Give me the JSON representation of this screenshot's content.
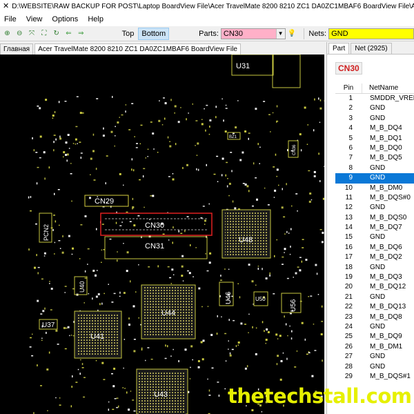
{
  "window": {
    "title": "D:\\WEBSITE\\RAW BACKUP FOR POST\\Laptop BoardView File\\Acer TravelMate 8200 8210 ZC1 DA0ZC1MBAF6 BoardView File\\Acer TravelMate 8200 8210 ZC1 DA0ZC1MBAF6 BoardView File"
  },
  "menu": [
    "File",
    "View",
    "Options",
    "Help"
  ],
  "toolbar": {
    "side_top": "Top",
    "side_bottom": "Bottom",
    "parts_label": "Parts:",
    "parts_value": "CN30",
    "nets_label": "Nets:",
    "nets_value": "GND",
    "parts_color": "#ffb0c8",
    "nets_color": "#ffff00"
  },
  "tabs": [
    "Главная",
    "Acer TravelMate 8200 8210 ZC1 DA0ZC1MBAF6 BoardView File"
  ],
  "panel": {
    "tabs": [
      "Part",
      "Net (2925)"
    ],
    "part_name": "CN30",
    "col_pin": "Pin",
    "col_net": "NetName",
    "selected_index": 8,
    "rows": [
      {
        "pin": "1",
        "net": "SMDDR_VREF_"
      },
      {
        "pin": "2",
        "net": "GND"
      },
      {
        "pin": "3",
        "net": "GND"
      },
      {
        "pin": "4",
        "net": "M_B_DQ4"
      },
      {
        "pin": "5",
        "net": "M_B_DQ1"
      },
      {
        "pin": "6",
        "net": "M_B_DQ0"
      },
      {
        "pin": "7",
        "net": "M_B_DQ5"
      },
      {
        "pin": "8",
        "net": "GND"
      },
      {
        "pin": "9",
        "net": "GND"
      },
      {
        "pin": "10",
        "net": "M_B_DM0"
      },
      {
        "pin": "11",
        "net": "M_B_DQS#0"
      },
      {
        "pin": "12",
        "net": "GND"
      },
      {
        "pin": "13",
        "net": "M_B_DQS0"
      },
      {
        "pin": "14",
        "net": "M_B_DQ7"
      },
      {
        "pin": "15",
        "net": "GND"
      },
      {
        "pin": "16",
        "net": "M_B_DQ6"
      },
      {
        "pin": "17",
        "net": "M_B_DQ2"
      },
      {
        "pin": "18",
        "net": "GND"
      },
      {
        "pin": "19",
        "net": "M_B_DQ3"
      },
      {
        "pin": "20",
        "net": "M_B_DQ12"
      },
      {
        "pin": "21",
        "net": "GND"
      },
      {
        "pin": "22",
        "net": "M_B_DQ13"
      },
      {
        "pin": "23",
        "net": "M_B_DQ8"
      },
      {
        "pin": "24",
        "net": "GND"
      },
      {
        "pin": "25",
        "net": "M_B_DQ9"
      },
      {
        "pin": "26",
        "net": "M_B_DM1"
      },
      {
        "pin": "27",
        "net": "GND"
      },
      {
        "pin": "28",
        "net": "GND"
      },
      {
        "pin": "29",
        "net": "M_B_DQS#1"
      }
    ]
  },
  "board": {
    "labels": [
      "U31",
      "CN29",
      "CN30",
      "CN31",
      "PCN2",
      "U48",
      "U40",
      "U44",
      "U46",
      "U50",
      "U56",
      "U37",
      "U41",
      "U43",
      "BZ1",
      "CN36"
    ]
  },
  "watermark": "thetechstall.com"
}
